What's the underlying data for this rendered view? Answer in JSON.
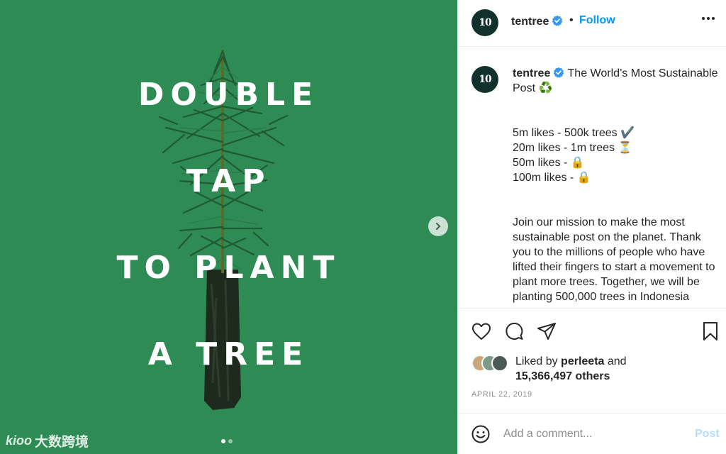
{
  "media": {
    "headline": [
      "DOUBLE",
      "TAP",
      "TO PLANT",
      "A TREE"
    ],
    "slide_count": 2,
    "active_slide": 1,
    "watermark_text": "大数跨境",
    "watermark_logo": "kioo"
  },
  "header": {
    "avatar_text": "10",
    "username": "tentree",
    "separator": "•",
    "follow_label": "Follow"
  },
  "caption": {
    "avatar_text": "10",
    "username": "tentree",
    "title": "The World’s Most Sustainable Post ♻️",
    "milestones": [
      "5m likes - 500k trees ✔️",
      "20m likes - 1m trees ⏳",
      "50m likes - 🔒",
      "100m likes - 🔒"
    ],
    "body": "Join our mission to make the most sustainable post on the planet. Thank you to the millions of people who have lifted their fingers to start a movement to plant more trees. Together, we will be planting 500,000 trees in Indonesia"
  },
  "actions": {
    "liked_by_prefix": "Liked by",
    "liked_by_user": "perleeta",
    "liked_by_and": "and",
    "others_count": "15,366,497 others",
    "date": "APRIL 22, 2019"
  },
  "comment": {
    "placeholder": "Add a comment...",
    "post_label": "Post"
  },
  "colors": {
    "media_bg": "#2e8b54",
    "accent": "#0095f6",
    "post_disabled": "#b2dffc",
    "avatar_bg": "#12312c"
  }
}
